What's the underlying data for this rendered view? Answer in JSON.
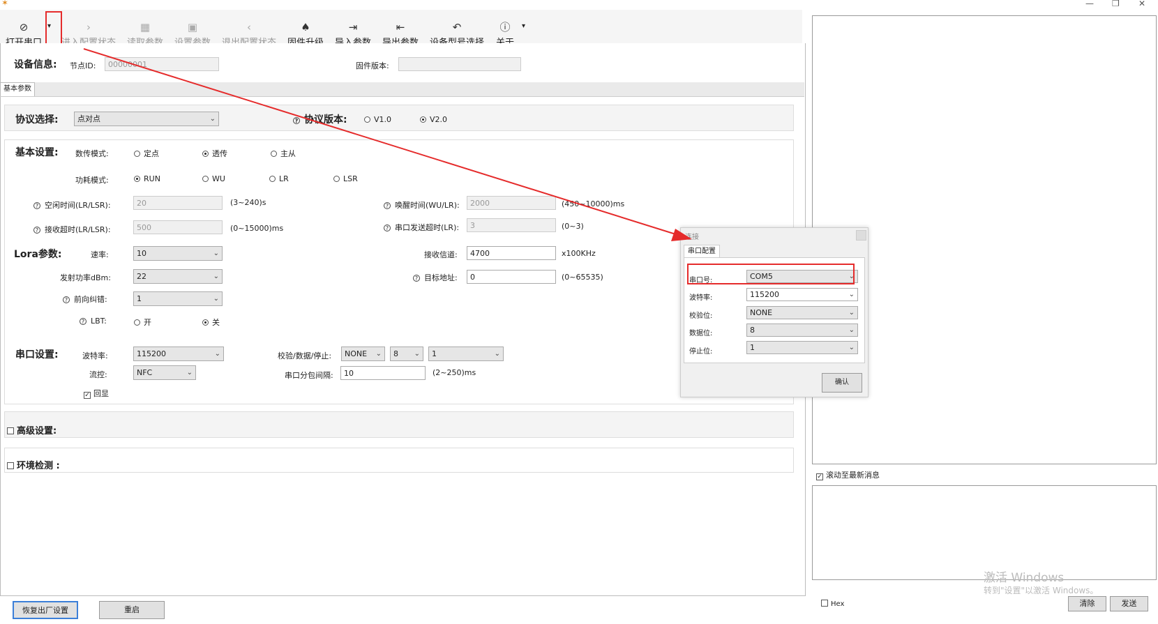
{
  "title_icon": "app-logo",
  "window_controls": {
    "minimize": "—",
    "restore": "❐",
    "close": "✕"
  },
  "toolbar": {
    "open_port": "打开串口",
    "enter_config": "进入配置状态",
    "read_params": "读取参数",
    "set_params": "设置参数",
    "exit_config": "退出配置状态",
    "firmware_upgrade": "固件升级",
    "import_params": "导入参数",
    "export_params": "导出参数",
    "device_model": "设备型号选择",
    "about": "关于"
  },
  "device_info": {
    "heading": "设备信息:",
    "node_id_label": "节点ID:",
    "node_id_value": "00000001",
    "fw_label": "固件版本:",
    "fw_value": ""
  },
  "tab": {
    "basic": "基本参数"
  },
  "protocol": {
    "heading": "协议选择:",
    "selected": "点对点",
    "version_label": "协议版本:",
    "v1": "V1.0",
    "v2": "V2.0"
  },
  "basic": {
    "heading": "基本设置:",
    "transfer_mode_label": "数传模式:",
    "mode_fixed": "定点",
    "mode_transparent": "透传",
    "mode_master": "主从",
    "power_mode_label": "功耗模式:",
    "pm_run": "RUN",
    "pm_wu": "WU",
    "pm_lr": "LR",
    "pm_lsr": "LSR",
    "idle_label": "空闲时间(LR/LSR):",
    "idle_value": "20",
    "idle_range": "(3~240)s",
    "wake_label": "唤醒时间(WU/LR):",
    "wake_value": "2000",
    "wake_range": "(450~10000)ms",
    "rx_timeout_label": "接收超时(LR/LSR):",
    "rx_timeout_value": "500",
    "rx_timeout_range": "(0~15000)ms",
    "tx_timeout_label": "串口发送超时(LR):",
    "tx_timeout_value": "3",
    "tx_timeout_range": "(0~3)"
  },
  "lora": {
    "heading": "Lora参数:",
    "rate_label": "速率:",
    "rate_value": "10",
    "power_label": "发射功率dBm:",
    "power_value": "22",
    "fec_label": "前向纠错:",
    "fec_value": "1",
    "lbt_label": "LBT:",
    "lbt_on": "开",
    "lbt_off": "关",
    "rx_channel_label": "接收信道:",
    "rx_channel_value": "4700",
    "rx_channel_unit": "x100KHz",
    "target_label": "目标地址:",
    "target_value": "0",
    "target_range": "(0~65535)"
  },
  "serial": {
    "heading": "串口设置:",
    "baud_label": "波特率:",
    "baud_value": "115200",
    "flow_label": "流控:",
    "flow_value": "NFC",
    "echo_label": "回显",
    "parity_label": "校验/数据/停止:",
    "parity_value": "NONE",
    "data_value": "8",
    "stop_value": "1",
    "packet_label": "串口分包间隔:",
    "packet_value": "10",
    "packet_range": "(2~250)ms"
  },
  "advanced": {
    "label": "高级设置:"
  },
  "env": {
    "label": "环境检测 :"
  },
  "bottom": {
    "factory_reset": "恢复出厂设置",
    "restart": "重启"
  },
  "right": {
    "scroll_label": "滚动至最新消息",
    "hex_label": "Hex",
    "clear": "清除",
    "send": "发送",
    "watermark_1": "激活 Windows",
    "watermark_2": "转到\"设置\"以激活 Windows。"
  },
  "dialog": {
    "title": "连接",
    "tab": "串口配置",
    "port_label": "串口号:",
    "port_value": "COM5",
    "baud_label": "波特率:",
    "baud_value": "115200",
    "parity_label": "校验位:",
    "parity_value": "NONE",
    "data_label": "数据位:",
    "data_value": "8",
    "stop_label": "停止位:",
    "stop_value": "1",
    "confirm": "确认"
  },
  "colors": {
    "annotation_red": "#e52b2b",
    "toolbar_bg": "#f5f5f5",
    "section_bg": "#f4f4f4"
  }
}
